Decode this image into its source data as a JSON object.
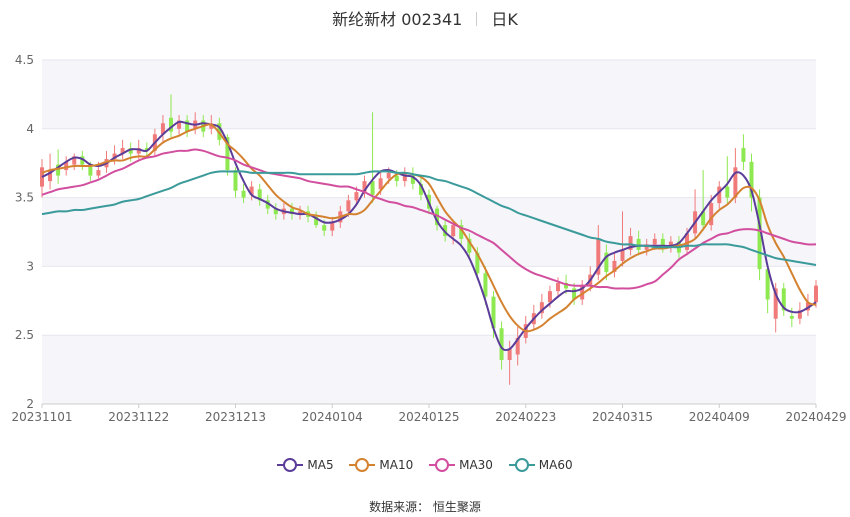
{
  "title": {
    "name": "新纶新材 002341",
    "period": "日K"
  },
  "source": {
    "label": "数据来源：",
    "value": "恒生聚源"
  },
  "legend": [
    {
      "name": "MA5",
      "color": "#5b3d99"
    },
    {
      "name": "MA10",
      "color": "#d4822f"
    },
    {
      "name": "MA30",
      "color": "#d24f9f"
    },
    {
      "name": "MA60",
      "color": "#3b9a9a"
    }
  ],
  "colors": {
    "up": "#f07a7a",
    "down": "#8ee84f",
    "grid": "#e6e6ee",
    "band": "#f5f5fa"
  },
  "chart_data": {
    "type": "candlestick",
    "ylim": [
      2,
      4.5
    ],
    "yticks": [
      "2",
      "2.5",
      "3",
      "3.5",
      "4",
      "4.5"
    ],
    "xticks": [
      "20231101",
      "20231122",
      "20231213",
      "20240104",
      "20240125",
      "20240223",
      "20240315",
      "20240409",
      "20240429"
    ],
    "series": [
      {
        "name": "MA5",
        "color": "#5b3d99",
        "values": [
          3.65,
          3.68,
          3.72,
          3.76,
          3.79,
          3.78,
          3.74,
          3.73,
          3.75,
          3.79,
          3.82,
          3.85,
          3.85,
          3.84,
          3.9,
          3.96,
          4.01,
          4.05,
          4.04,
          4.03,
          4.04,
          4.03,
          4.01,
          3.9,
          3.75,
          3.62,
          3.52,
          3.49,
          3.46,
          3.42,
          3.4,
          3.39,
          3.38,
          3.38,
          3.35,
          3.32,
          3.32,
          3.34,
          3.38,
          3.45,
          3.55,
          3.63,
          3.69,
          3.7,
          3.68,
          3.66,
          3.65,
          3.59,
          3.46,
          3.33,
          3.25,
          3.2,
          3.15,
          3.06,
          2.92,
          2.75,
          2.55,
          2.41,
          2.4,
          2.47,
          2.55,
          2.62,
          2.68,
          2.73,
          2.78,
          2.82,
          2.82,
          2.84,
          2.9,
          2.99,
          3.07,
          3.1,
          3.12,
          3.14,
          3.15,
          3.15,
          3.15,
          3.15,
          3.15,
          3.17,
          3.24,
          3.32,
          3.4,
          3.48,
          3.54,
          3.6,
          3.68,
          3.66,
          3.55,
          3.3,
          3.0,
          2.8,
          2.7,
          2.67,
          2.67,
          2.7,
          2.74
        ]
      },
      {
        "name": "MA10",
        "color": "#d4822f",
        "values": [
          3.68,
          3.7,
          3.71,
          3.72,
          3.73,
          3.73,
          3.73,
          3.74,
          3.76,
          3.77,
          3.77,
          3.79,
          3.8,
          3.8,
          3.85,
          3.9,
          3.93,
          3.95,
          3.98,
          4.0,
          4.02,
          4.03,
          3.97,
          3.89,
          3.84,
          3.78,
          3.71,
          3.66,
          3.59,
          3.52,
          3.47,
          3.43,
          3.41,
          3.38,
          3.37,
          3.36,
          3.35,
          3.36,
          3.38,
          3.38,
          3.41,
          3.48,
          3.55,
          3.62,
          3.67,
          3.68,
          3.67,
          3.65,
          3.6,
          3.5,
          3.4,
          3.33,
          3.27,
          3.18,
          3.09,
          2.98,
          2.86,
          2.74,
          2.64,
          2.57,
          2.53,
          2.54,
          2.57,
          2.62,
          2.66,
          2.7,
          2.76,
          2.8,
          2.84,
          2.88,
          2.93,
          2.97,
          3.02,
          3.06,
          3.09,
          3.11,
          3.13,
          3.13,
          3.14,
          3.15,
          3.17,
          3.2,
          3.27,
          3.35,
          3.41,
          3.45,
          3.51,
          3.57,
          3.57,
          3.48,
          3.3,
          3.17,
          3.07,
          2.95,
          2.83,
          2.74,
          2.72
        ]
      },
      {
        "name": "MA30",
        "color": "#d24f9f",
        "values": [
          3.52,
          3.54,
          3.56,
          3.57,
          3.58,
          3.59,
          3.61,
          3.63,
          3.66,
          3.69,
          3.71,
          3.74,
          3.77,
          3.79,
          3.8,
          3.82,
          3.83,
          3.84,
          3.84,
          3.85,
          3.84,
          3.82,
          3.8,
          3.79,
          3.77,
          3.74,
          3.72,
          3.7,
          3.68,
          3.67,
          3.66,
          3.65,
          3.64,
          3.62,
          3.61,
          3.6,
          3.59,
          3.58,
          3.58,
          3.56,
          3.54,
          3.51,
          3.49,
          3.47,
          3.46,
          3.44,
          3.43,
          3.41,
          3.39,
          3.37,
          3.34,
          3.31,
          3.28,
          3.26,
          3.23,
          3.2,
          3.17,
          3.12,
          3.07,
          3.02,
          2.98,
          2.95,
          2.93,
          2.91,
          2.89,
          2.87,
          2.86,
          2.86,
          2.86,
          2.85,
          2.85,
          2.84,
          2.84,
          2.84,
          2.85,
          2.87,
          2.89,
          2.94,
          2.99,
          3.05,
          3.09,
          3.13,
          3.17,
          3.2,
          3.23,
          3.24,
          3.26,
          3.27,
          3.27,
          3.26,
          3.24,
          3.22,
          3.2,
          3.18,
          3.17,
          3.16,
          3.16
        ]
      },
      {
        "name": "MA60",
        "color": "#3b9a9a",
        "values": [
          3.38,
          3.39,
          3.4,
          3.4,
          3.41,
          3.41,
          3.42,
          3.43,
          3.44,
          3.45,
          3.47,
          3.48,
          3.49,
          3.51,
          3.53,
          3.55,
          3.57,
          3.6,
          3.62,
          3.64,
          3.66,
          3.68,
          3.69,
          3.69,
          3.69,
          3.69,
          3.68,
          3.68,
          3.68,
          3.68,
          3.68,
          3.68,
          3.67,
          3.67,
          3.67,
          3.67,
          3.67,
          3.67,
          3.67,
          3.67,
          3.68,
          3.69,
          3.69,
          3.69,
          3.68,
          3.68,
          3.67,
          3.66,
          3.65,
          3.63,
          3.62,
          3.6,
          3.58,
          3.56,
          3.53,
          3.5,
          3.47,
          3.44,
          3.42,
          3.39,
          3.37,
          3.35,
          3.33,
          3.31,
          3.29,
          3.27,
          3.25,
          3.23,
          3.21,
          3.2,
          3.18,
          3.17,
          3.16,
          3.16,
          3.15,
          3.15,
          3.14,
          3.14,
          3.14,
          3.14,
          3.15,
          3.15,
          3.16,
          3.16,
          3.16,
          3.16,
          3.15,
          3.14,
          3.12,
          3.1,
          3.08,
          3.06,
          3.05,
          3.04,
          3.03,
          3.02,
          3.01
        ]
      }
    ],
    "candles": [
      [
        3.58,
        3.72,
        3.78,
        3.5
      ],
      [
        3.62,
        3.7,
        3.82,
        3.56
      ],
      [
        3.74,
        3.66,
        3.85,
        3.6
      ],
      [
        3.7,
        3.76,
        3.8,
        3.66
      ],
      [
        3.74,
        3.8,
        3.82,
        3.7
      ],
      [
        3.8,
        3.74,
        3.84,
        3.7
      ],
      [
        3.74,
        3.66,
        3.76,
        3.62
      ],
      [
        3.66,
        3.7,
        3.76,
        3.64
      ],
      [
        3.72,
        3.78,
        3.84,
        3.68
      ],
      [
        3.78,
        3.82,
        3.88,
        3.74
      ],
      [
        3.82,
        3.86,
        3.92,
        3.78
      ],
      [
        3.86,
        3.82,
        3.9,
        3.76
      ],
      [
        3.82,
        3.86,
        3.92,
        3.78
      ],
      [
        3.86,
        3.84,
        3.9,
        3.8
      ],
      [
        3.84,
        3.96,
        4.0,
        3.8
      ],
      [
        3.96,
        4.04,
        4.1,
        3.9
      ],
      [
        4.08,
        3.98,
        4.25,
        3.94
      ],
      [
        4.0,
        4.06,
        4.1,
        3.96
      ],
      [
        4.06,
        3.98,
        4.1,
        3.94
      ],
      [
        4.0,
        4.06,
        4.12,
        3.96
      ],
      [
        4.06,
        3.98,
        4.1,
        3.94
      ],
      [
        4.0,
        4.04,
        4.1,
        3.96
      ],
      [
        4.04,
        3.92,
        4.08,
        3.88
      ],
      [
        3.94,
        3.7,
        3.96,
        3.66
      ],
      [
        3.7,
        3.55,
        3.72,
        3.5
      ],
      [
        3.55,
        3.5,
        3.6,
        3.46
      ],
      [
        3.52,
        3.58,
        3.62,
        3.48
      ],
      [
        3.56,
        3.48,
        3.6,
        3.44
      ],
      [
        3.48,
        3.42,
        3.52,
        3.38
      ],
      [
        3.42,
        3.38,
        3.46,
        3.34
      ],
      [
        3.38,
        3.42,
        3.46,
        3.34
      ],
      [
        3.42,
        3.38,
        3.46,
        3.34
      ],
      [
        3.38,
        3.4,
        3.44,
        3.34
      ],
      [
        3.4,
        3.36,
        3.44,
        3.32
      ],
      [
        3.36,
        3.3,
        3.4,
        3.28
      ],
      [
        3.3,
        3.26,
        3.34,
        3.22
      ],
      [
        3.26,
        3.32,
        3.36,
        3.22
      ],
      [
        3.32,
        3.4,
        3.44,
        3.28
      ],
      [
        3.4,
        3.48,
        3.52,
        3.36
      ],
      [
        3.48,
        3.54,
        3.58,
        3.44
      ],
      [
        3.54,
        3.62,
        3.66,
        3.5
      ],
      [
        3.62,
        3.52,
        4.12,
        3.46
      ],
      [
        3.56,
        3.64,
        3.7,
        3.52
      ],
      [
        3.64,
        3.68,
        3.72,
        3.6
      ],
      [
        3.66,
        3.62,
        3.7,
        3.58
      ],
      [
        3.62,
        3.68,
        3.72,
        3.58
      ],
      [
        3.66,
        3.6,
        3.72,
        3.56
      ],
      [
        3.6,
        3.52,
        3.64,
        3.48
      ],
      [
        3.52,
        3.42,
        3.56,
        3.38
      ],
      [
        3.42,
        3.3,
        3.44,
        3.26
      ],
      [
        3.3,
        3.22,
        3.34,
        3.18
      ],
      [
        3.22,
        3.3,
        3.34,
        3.16
      ],
      [
        3.3,
        3.2,
        3.34,
        3.14
      ],
      [
        3.2,
        3.1,
        3.24,
        3.06
      ],
      [
        3.1,
        2.95,
        3.14,
        2.9
      ],
      [
        2.95,
        2.78,
        3.0,
        2.72
      ],
      [
        2.78,
        2.55,
        2.82,
        2.48
      ],
      [
        2.55,
        2.32,
        2.6,
        2.25
      ],
      [
        2.32,
        2.4,
        2.46,
        2.14
      ],
      [
        2.36,
        2.48,
        2.56,
        2.28
      ],
      [
        2.48,
        2.58,
        2.64,
        2.44
      ],
      [
        2.58,
        2.66,
        2.72,
        2.54
      ],
      [
        2.66,
        2.74,
        2.8,
        2.62
      ],
      [
        2.74,
        2.82,
        2.86,
        2.7
      ],
      [
        2.82,
        2.88,
        2.92,
        2.78
      ],
      [
        2.88,
        2.84,
        2.94,
        2.8
      ],
      [
        2.84,
        2.76,
        2.88,
        2.72
      ],
      [
        2.76,
        2.86,
        2.9,
        2.72
      ],
      [
        2.86,
        2.94,
        3.0,
        2.82
      ],
      [
        2.94,
        3.2,
        3.3,
        2.9
      ],
      [
        3.1,
        2.96,
        3.16,
        2.9
      ],
      [
        2.96,
        3.04,
        3.1,
        2.92
      ],
      [
        3.04,
        3.12,
        3.4,
        3.0
      ],
      [
        3.12,
        3.22,
        3.28,
        3.08
      ],
      [
        3.2,
        3.12,
        3.26,
        3.08
      ],
      [
        3.12,
        3.16,
        3.2,
        3.08
      ],
      [
        3.16,
        3.2,
        3.24,
        3.12
      ],
      [
        3.2,
        3.14,
        3.24,
        3.1
      ],
      [
        3.14,
        3.18,
        3.22,
        3.1
      ],
      [
        3.18,
        3.1,
        3.22,
        3.06
      ],
      [
        3.12,
        3.24,
        3.28,
        3.08
      ],
      [
        3.24,
        3.4,
        3.56,
        3.2
      ],
      [
        3.4,
        3.3,
        3.7,
        3.26
      ],
      [
        3.3,
        3.46,
        3.52,
        3.26
      ],
      [
        3.46,
        3.58,
        3.62,
        3.42
      ],
      [
        3.58,
        3.5,
        3.8,
        3.46
      ],
      [
        3.5,
        3.72,
        3.86,
        3.46
      ],
      [
        3.86,
        3.76,
        3.96,
        3.7
      ],
      [
        3.76,
        3.5,
        3.82,
        3.4
      ],
      [
        3.5,
        2.98,
        3.56,
        2.9
      ],
      [
        2.98,
        2.76,
        3.02,
        2.66
      ],
      [
        2.62,
        2.84,
        2.88,
        2.52
      ],
      [
        2.84,
        2.68,
        2.88,
        2.64
      ],
      [
        2.64,
        2.62,
        2.7,
        2.56
      ],
      [
        2.62,
        2.68,
        2.74,
        2.58
      ],
      [
        2.68,
        2.74,
        2.8,
        2.64
      ],
      [
        2.74,
        2.86,
        2.9,
        2.7
      ]
    ]
  }
}
